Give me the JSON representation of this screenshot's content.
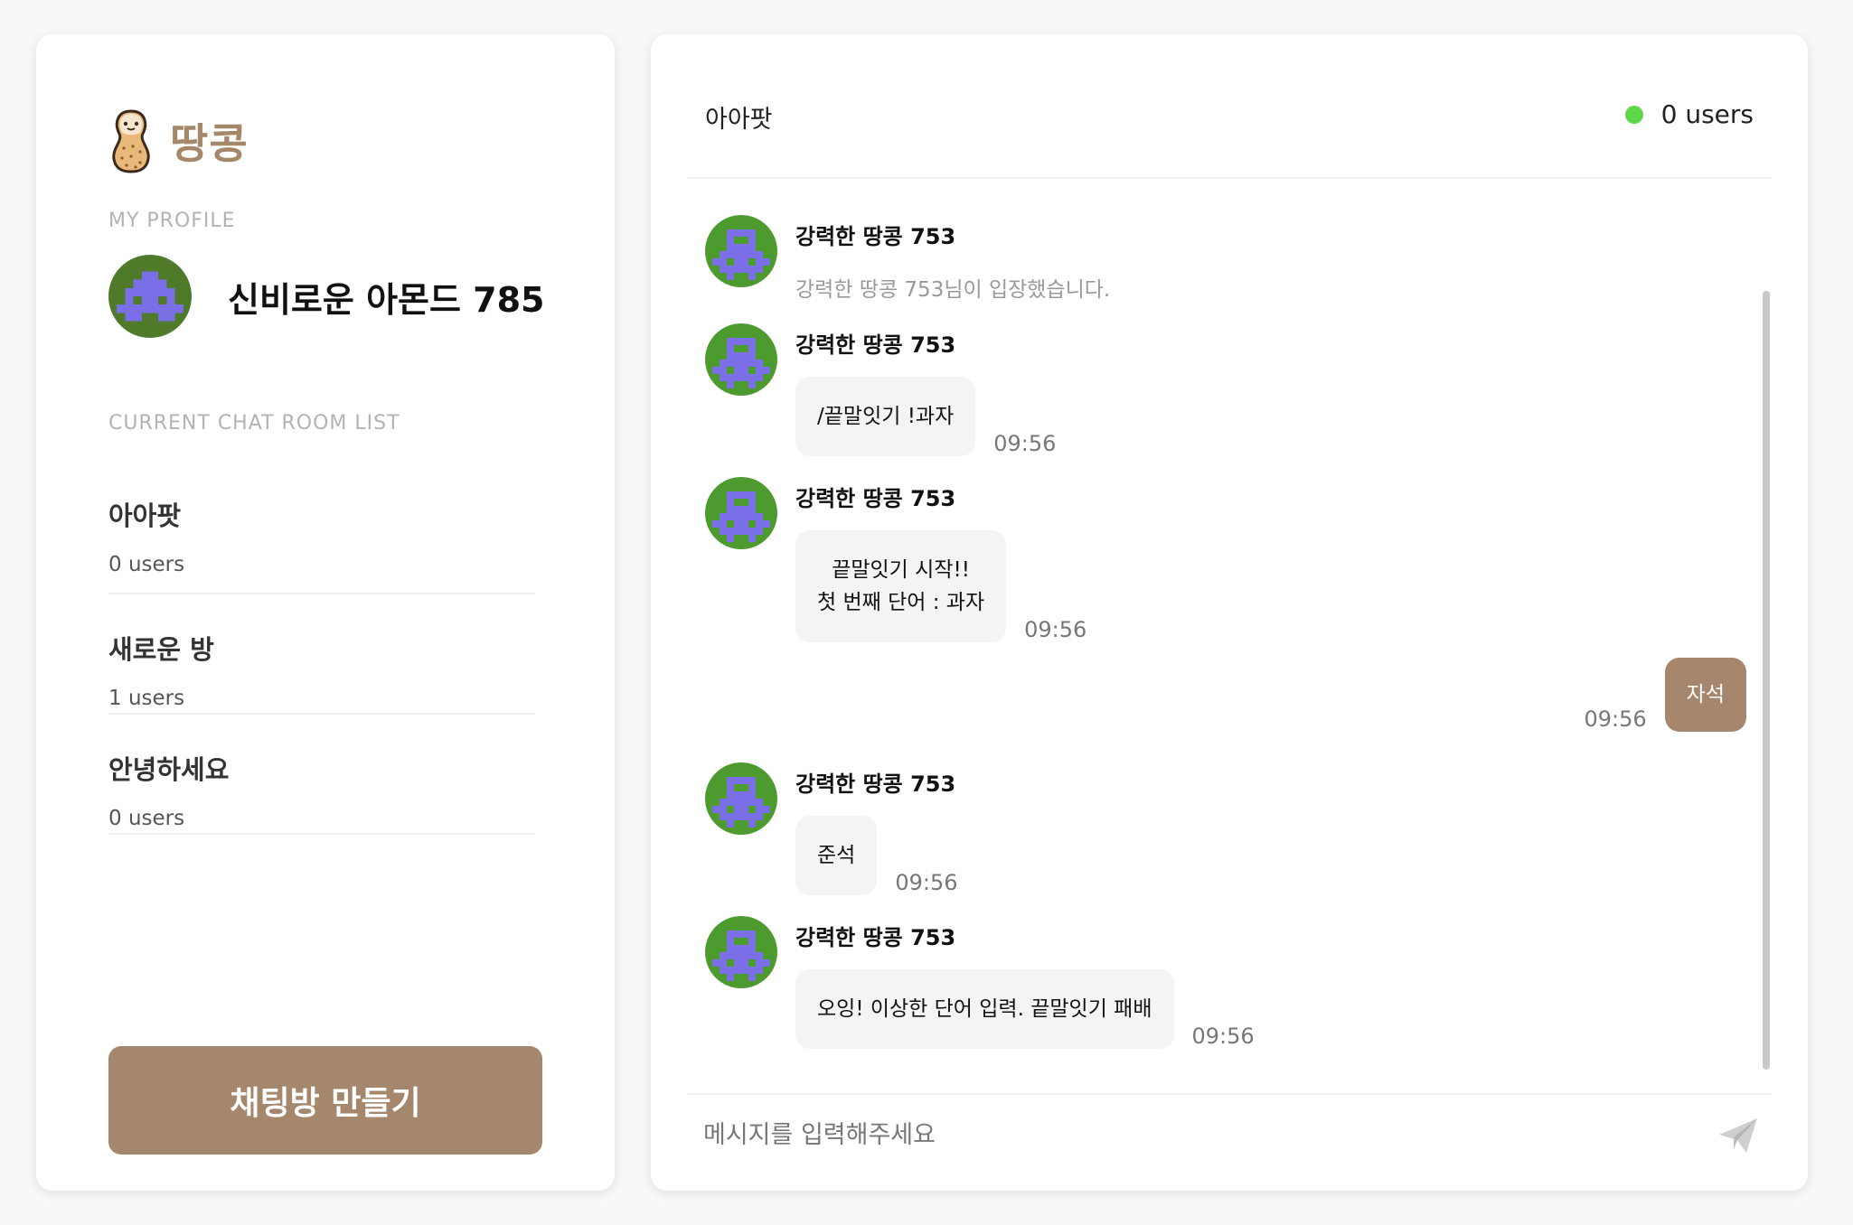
{
  "brand": {
    "name": "땅콩",
    "accent": "#a5876a"
  },
  "profile": {
    "section_label": "MY PROFILE",
    "name": "신비로운 아몬드 785",
    "avatar_bg": "#4e7a2a",
    "avatar_fg": "#7b6fe8"
  },
  "room_list": {
    "section_label": "CURRENT CHAT ROOM LIST",
    "rooms": [
      {
        "name": "아아팟",
        "users": "0 users"
      },
      {
        "name": "새로운 방",
        "users": "1 users"
      },
      {
        "name": "안녕하세요",
        "users": "0 users"
      }
    ]
  },
  "create_room_label": "채팅방 만들기",
  "chat": {
    "title": "아아팟",
    "online_users": "0 users",
    "online_color": "#5fd74a",
    "messages": [
      {
        "sender": "강력한 땅콩 753",
        "system_text": "강력한 땅콩 753님이 입장했습니다."
      },
      {
        "sender": "강력한 땅콩 753",
        "text": "/끝말잇기 !과자",
        "time": "09:56"
      },
      {
        "sender": "강력한 땅콩 753",
        "text": "끝말잇기 시작!!\n첫 번째 단어 : 과자",
        "time": "09:56"
      },
      {
        "mine": true,
        "text": "자석",
        "time": "09:56"
      },
      {
        "sender": "강력한 땅콩 753",
        "text": "준석",
        "time": "09:56"
      },
      {
        "sender": "강력한 땅콩 753",
        "text": "오잉! 이상한 단어 입력. 끝말잇기 패배",
        "time": "09:56"
      }
    ],
    "input_placeholder": "메시지를 입력해주세요"
  }
}
